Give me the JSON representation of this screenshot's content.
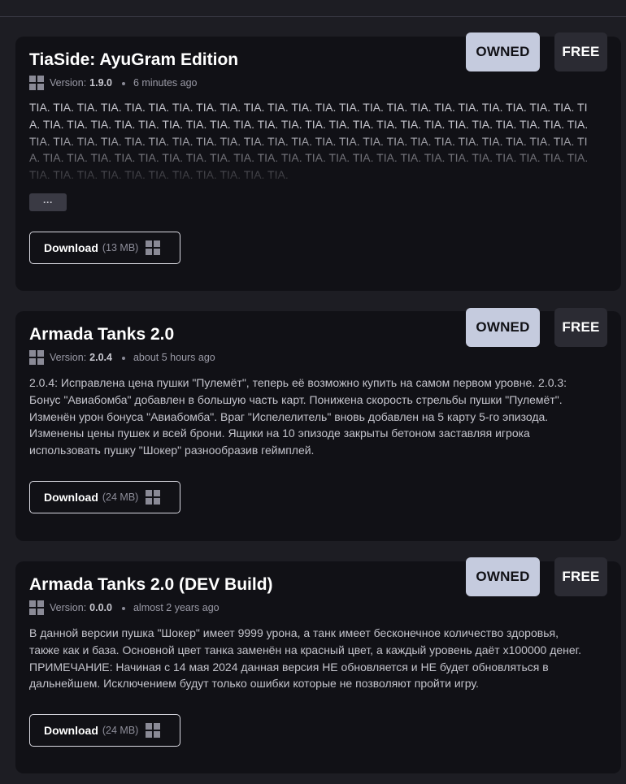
{
  "items": [
    {
      "title": "TiaSide: AyuGram Edition",
      "version_label": "Version:",
      "version": "1.9.0",
      "updated": "6 minutes ago",
      "owned_label": "OWNED",
      "price_label": "FREE",
      "description": "TIA. TIA. TIA. TIA. TIA. TIA. TIA. TIA. TIA. TIA. TIA. TIA. TIA. TIA. TIA. TIA. TIA. TIA. TIA. TIA. TIA. TIA. TIA. TIA. TIA. TIA. TIA. TIA. TIA. TIA. TIA. TIA. TIA. TIA. TIA. TIA. TIA. TIA. TIA. TIA. TIA. TIA. TIA. TIA. TIA. TIA. TIA. TIA. TIA. TIA. TIA. TIA. TIA. TIA. TIA. TIA. TIA. TIA. TIA. TIA. TIA. TIA. TIA. TIA. TIA. TIA. TIA. TIA. TIA. TIA. TIA. TIA. TIA. TIA. TIA. TIA. TIA. TIA. TIA. TIA. TIA. TIA. TIA. TIA. TIA. TIA. TIA. TIA. TIA. TIA. TIA. TIA. TIA. TIA. TIA. TIA. TIA. TIA. TIA. TIA. TIA. TIA. TIA. TIA. TIA.",
      "more_label": "···",
      "download_label": "Download",
      "download_size": "(13 MB)"
    },
    {
      "title": "Armada Tanks 2.0",
      "version_label": "Version:",
      "version": "2.0.4",
      "updated": "about 5 hours ago",
      "owned_label": "OWNED",
      "price_label": "FREE",
      "description": "2.0.4: Исправлена цена пушки \"Пулемёт\", теперь её возможно купить на самом первом уровне. 2.0.3: Бонус \"Авиабомба\" добавлен в большую часть карт. Понижена скорость стрельбы пушки \"Пулемёт\". Изменён урон бонуса \"Авиабомба\". Враг \"Испелелитель\" вновь добавлен на 5 карту 5-го эпизода. Изменены цены пушек и всей брони. Ящики на 10 эпизоде закрыты бетоном заставляя игрока использовать пушку \"Шокер\" разнообразив геймплей.",
      "download_label": "Download",
      "download_size": "(24 MB)"
    },
    {
      "title": "Armada Tanks 2.0 (DEV Build)",
      "version_label": "Version:",
      "version": "0.0.0",
      "updated": "almost 2 years ago",
      "owned_label": "OWNED",
      "price_label": "FREE",
      "description": "В данной версии пушка \"Шокер\" имеет 9999 урона, а танк имеет бесконечное количество здоровья, также как и база. Основной цвет танка заменён на красный цвет, а каждый уровень даёт x100000 денег. ПРИМЕЧАНИЕ: Начиная с 14 мая 2024 данная версия НЕ обновляется и НЕ будет обновляться в дальнейшем. Исключением будут только ошибки которые не позволяют пройти игру.",
      "download_label": "Download",
      "download_size": "(24 MB)"
    }
  ],
  "icons": {
    "platform": "windows-icon"
  },
  "colors": {
    "page_background": "#1d1d23",
    "card_background": "#111116",
    "owned_badge": "#c5cbde",
    "free_badge": "#2b2b33"
  }
}
